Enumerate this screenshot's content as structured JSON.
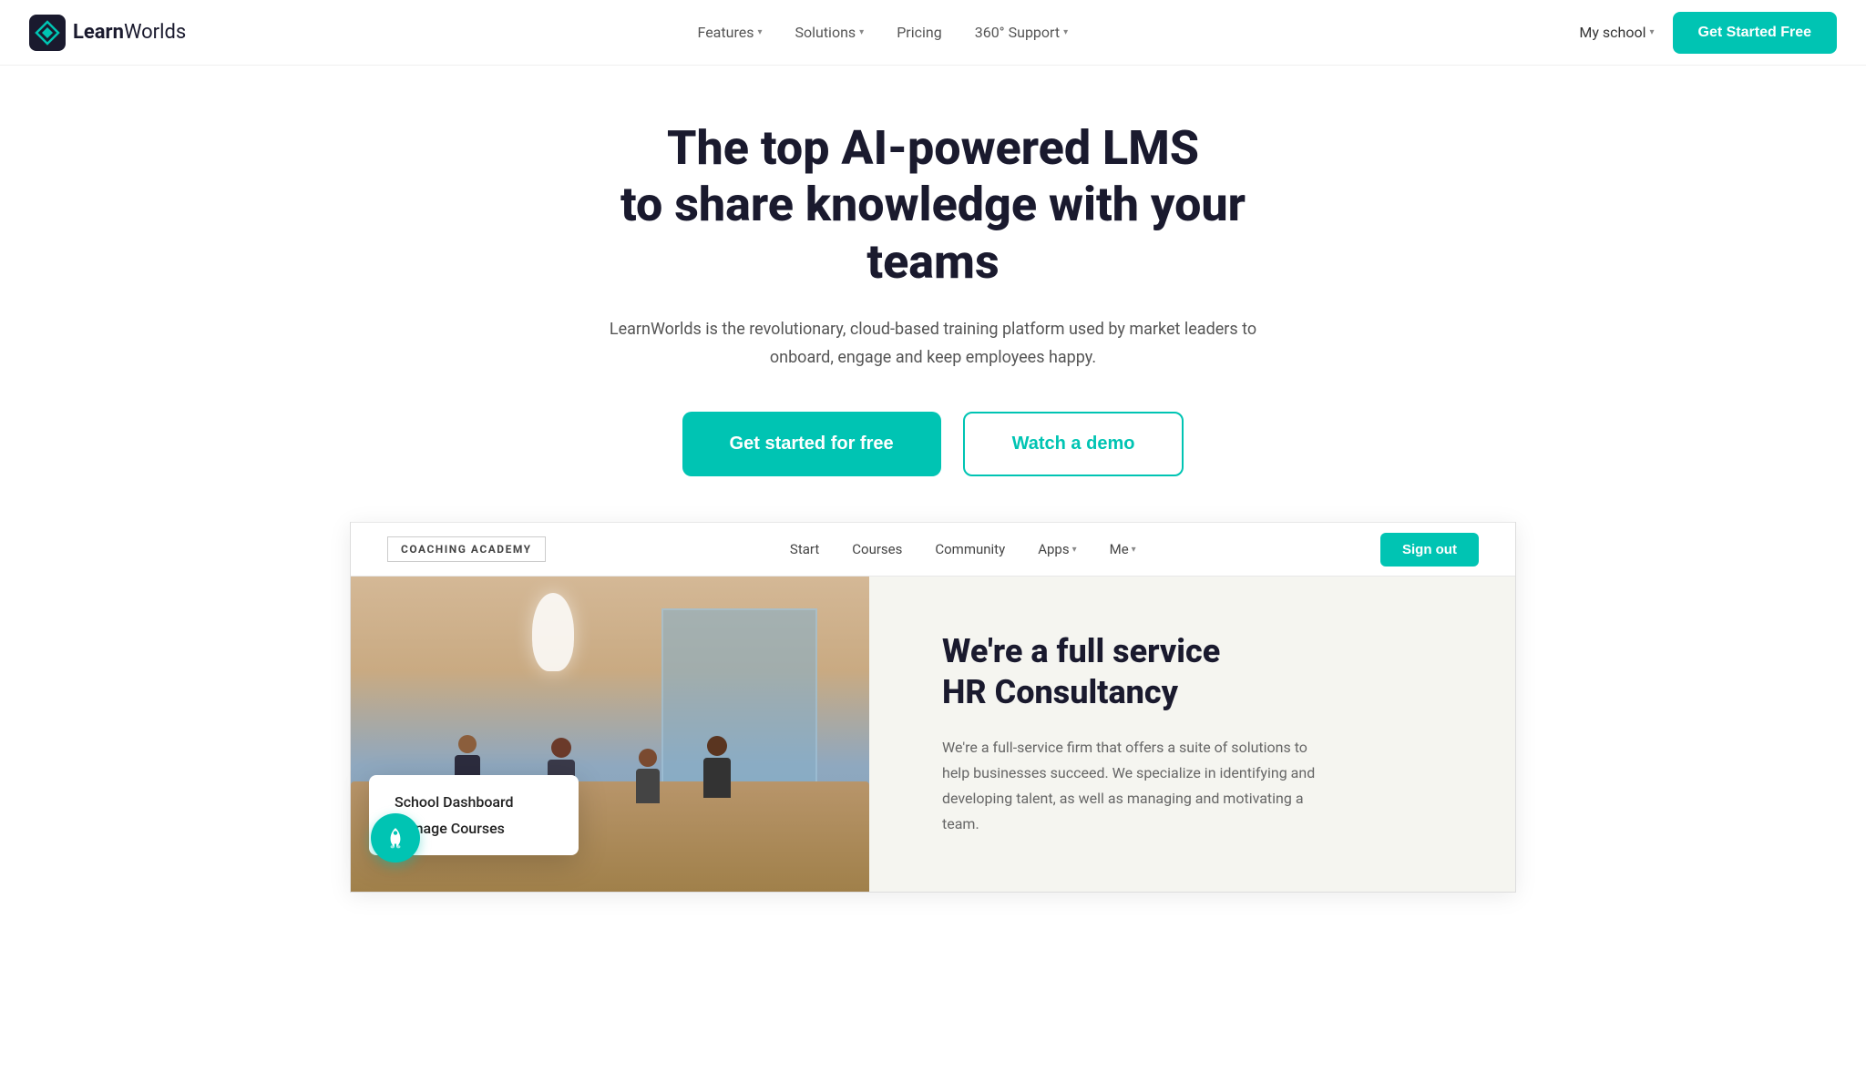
{
  "brand": {
    "name_bold": "Learn",
    "name_regular": "Worlds",
    "logo_alt": "LearnWorlds logo"
  },
  "navbar": {
    "features_label": "Features",
    "solutions_label": "Solutions",
    "pricing_label": "Pricing",
    "support_label": "360° Support",
    "my_school_label": "My school",
    "get_started_label": "Get Started Free"
  },
  "hero": {
    "headline_line1": "The top AI-powered LMS",
    "headline_line2": "to share knowledge with your teams",
    "description": "LearnWorlds is the revolutionary, cloud-based training platform used by market leaders to onboard, engage and keep employees happy.",
    "cta_primary": "Get started for free",
    "cta_secondary": "Watch a demo"
  },
  "inner_navbar": {
    "school_name": "COACHING ACADEMY",
    "links": [
      {
        "label": "Start"
      },
      {
        "label": "Courses"
      },
      {
        "label": "Community"
      },
      {
        "label": "Apps",
        "has_arrow": true
      },
      {
        "label": "Me",
        "has_arrow": true
      }
    ],
    "sign_out_label": "Sign out"
  },
  "content_preview": {
    "heading_line1": "We're a full service",
    "heading_line2": "HR Consultancy",
    "body": "We're a full-service firm that offers a suite of solutions to help businesses succeed. We specialize in identifying and developing talent, as well as managing and motivating a team."
  },
  "dashboard_popup": {
    "item1": "School Dashboard",
    "item2": "Manage Courses"
  },
  "colors": {
    "teal": "#00c4b3",
    "dark": "#1a1a2e",
    "text_gray": "#555555"
  }
}
